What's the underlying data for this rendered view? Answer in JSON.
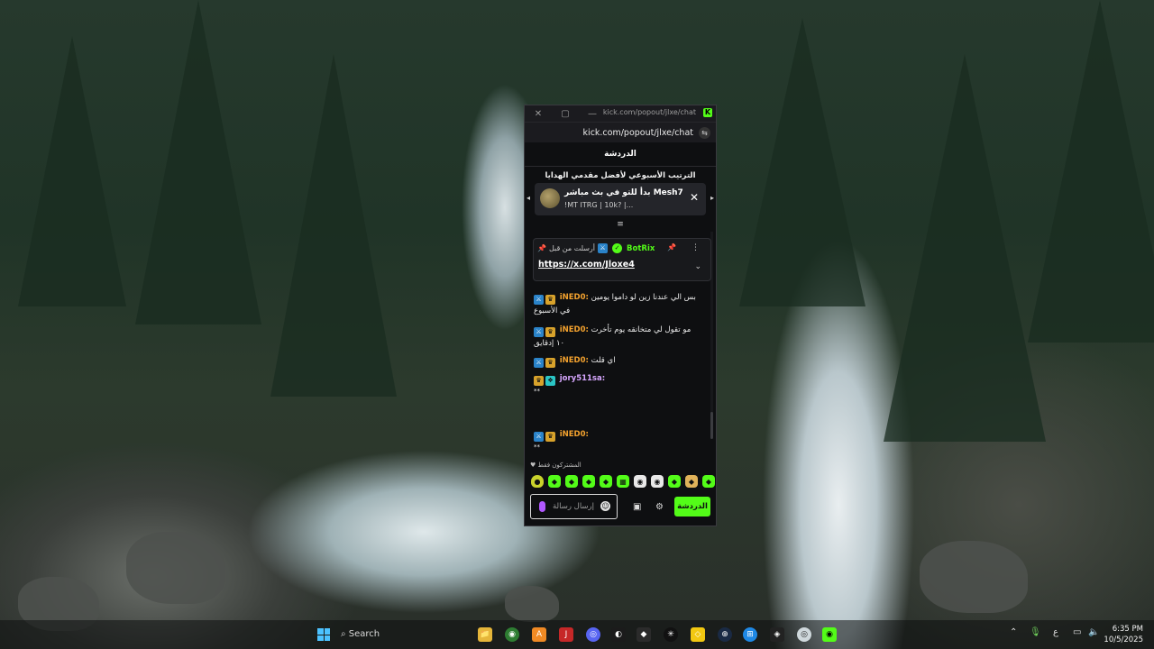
{
  "window": {
    "title_url": "kick.com/popout/jlxe/chat",
    "address_url": "kick.com/popout/jlxe/chat",
    "close_glyph": "✕",
    "max_glyph": "▢",
    "min_glyph": "—",
    "kick_badge": "K",
    "tune_icon": "⇆"
  },
  "chat": {
    "header": "الدردشة",
    "leaderboard_title": "الترتيب الأسبوعي لأفضل مقدمي الهدايا",
    "leaderboard_line1": "Mesh7 بدأ للتو في بث مباشر",
    "leaderboard_line2": "!MT ITRG | 10k? |...",
    "close": "✕",
    "prev": "◂",
    "next": "▸",
    "handle": "≡",
    "pinned": {
      "pinned_by": "أرسلت من قبل",
      "user": "BotRix",
      "link": "https://x.com/Jloxe4",
      "pin": "📌",
      "more": "⋮",
      "expand": "⌄"
    },
    "messages": [
      {
        "user": "iNED0:",
        "text": "بس الي عندنا زين لو داموا يومين في الأسبوع"
      },
      {
        "user": "iNED0:",
        "text": "مو تقول لي متخانقه يوم تأخرت ١٠ إدقايق"
      },
      {
        "user": "iNED0:",
        "text": "اي قلت"
      },
      {
        "user": "jory511sa:",
        "text": "*‪‪‪‪‪‪‪‪‪‪‪‪‪‪‪‪‪‪‪‪‪‪‪‪‪‪‪‪‪‪‪‪‪‪‪‪‪‪‪‪‪‪‪‪‪‪‪‪‪‪‪‪‪‪‪‪‪‪‪‪‪‪‪‪‪‪‪‪‪‪‪‪‪‪‪‪‪‪‪‪‪‪‪‪‪‪‪‪‪‪*"
      },
      {
        "user": "iNED0:",
        "text": "*‪‪‪‪‪‪‪‪‪‪‪‪‪‪‪‪‪‪‪‪‪‪‪‪‪‪‪‪‪‪‪‪‪‪‪‪*"
      }
    ],
    "subs_label": "المشتركون فقط",
    "input_placeholder": "إرسال رسالة",
    "send": "الدردشة",
    "store_icon": "▣",
    "settings_icon": "⚙",
    "emotes": [
      "●",
      "◆",
      "◆",
      "◆",
      "◆",
      "▦",
      "◉",
      "◉",
      "◆",
      "◆",
      "◆"
    ]
  },
  "taskbar": {
    "search": "Search",
    "time": "6:35 PM",
    "date": "10/5/2025",
    "lang": "ع",
    "apps": [
      "📁",
      "◉",
      "A",
      "J",
      "◎",
      "◐",
      "◆",
      "✳",
      "◇",
      "⊕",
      "⊞",
      "◈",
      "◎",
      "◉"
    ],
    "badge_count": "9+"
  }
}
